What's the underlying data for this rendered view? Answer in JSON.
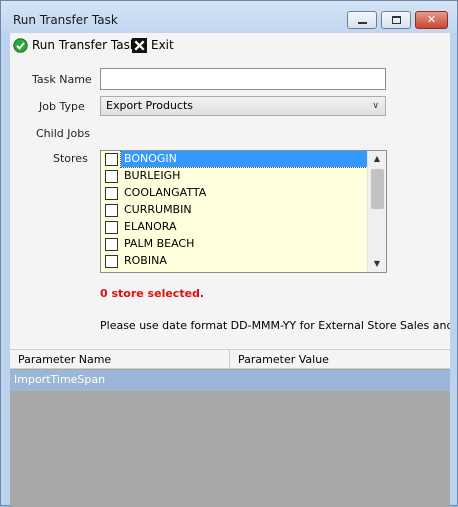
{
  "window": {
    "title": "Run Transfer Task"
  },
  "toolbar": {
    "run_label": "Run Transfer Task",
    "exit_label": "Exit"
  },
  "form": {
    "task_name_label": "Task Name",
    "task_name_value": "",
    "job_type_label": "Job Type",
    "job_type_value": "Export Products",
    "child_jobs_label": "Child Jobs",
    "stores_label": "Stores"
  },
  "stores": [
    {
      "name": "BONOGIN",
      "checked": false,
      "selected": true
    },
    {
      "name": "BURLEIGH",
      "checked": false,
      "selected": false
    },
    {
      "name": "COOLANGATTA",
      "checked": false,
      "selected": false
    },
    {
      "name": "CURRUMBIN",
      "checked": false,
      "selected": false
    },
    {
      "name": "ELANORA",
      "checked": false,
      "selected": false
    },
    {
      "name": "PALM BEACH",
      "checked": false,
      "selected": false
    },
    {
      "name": "ROBINA",
      "checked": false,
      "selected": false
    }
  ],
  "status": {
    "selected_count_text": "0 store selected."
  },
  "note": {
    "date_format_text": "Please use date format DD-MMM-YY for External Store Sales and Exte"
  },
  "parameters": {
    "columns": [
      "Parameter Name",
      "Parameter Value"
    ],
    "rows": [
      {
        "name": "ImportTimeSpan",
        "value": ""
      }
    ]
  },
  "colors": {
    "selection": "#3399ff",
    "list_bg": "#ffffde",
    "status_red": "#e01010",
    "row_highlight": "#9bb6d6"
  }
}
